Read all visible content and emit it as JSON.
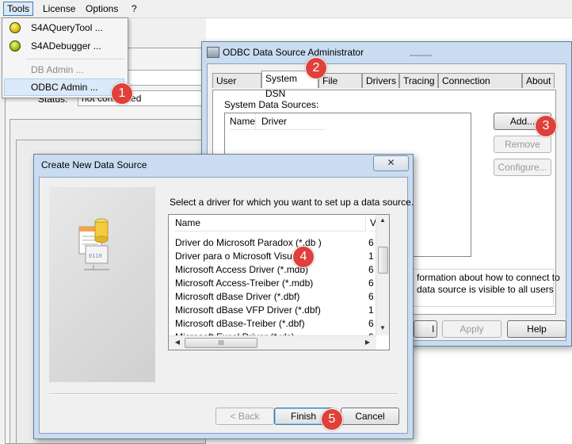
{
  "menubar": {
    "tools": "Tools",
    "license": "License",
    "options": "Options",
    "help": "?"
  },
  "tools_menu": {
    "items": [
      {
        "label": "S4AQueryTool ...",
        "icon": "yellow-ball-icon"
      },
      {
        "label": "S4ADebugger ...",
        "icon": "bug-icon"
      },
      {
        "label": "DB Admin ..."
      },
      {
        "label": "ODBC Admin ..."
      }
    ]
  },
  "background_app": {
    "status_label": "Status:",
    "status_value": "not connected"
  },
  "odbc": {
    "title": "ODBC Data Source Administrator",
    "tabs": [
      "User DSN",
      "System DSN",
      "File DSN",
      "Drivers",
      "Tracing",
      "Connection Pooling",
      "About"
    ],
    "section_label": "System Data Sources:",
    "columns": [
      "Name",
      "Driver"
    ],
    "buttons": {
      "add": "Add...",
      "remove": "Remove",
      "configure": "Configure...",
      "apply": "Apply",
      "help": "Help"
    },
    "info_line1": "formation about how to connect to",
    "info_line2": "data source is visible to all users"
  },
  "create_dialog": {
    "title": "Create New Data Source",
    "instruction": "Select a driver for which you want to set up a data source.",
    "columns": {
      "name": "Name",
      "version": "V"
    },
    "drivers": [
      {
        "name": "Driver do Microsoft Paradox (*.db )",
        "version": "6"
      },
      {
        "name": "Driver para o Microsoft Visual F",
        "version": "1"
      },
      {
        "name": "Microsoft Access Driver (*.mdb)",
        "version": "6"
      },
      {
        "name": "Microsoft Access-Treiber (*.mdb)",
        "version": "6"
      },
      {
        "name": "Microsoft dBase Driver (*.dbf)",
        "version": "6"
      },
      {
        "name": "Microsoft dBase VFP Driver (*.dbf)",
        "version": "1"
      },
      {
        "name": "Microsoft dBase-Treiber (*.dbf)",
        "version": "6"
      },
      {
        "name": "Microsoft Excel Driver (*.xls)",
        "version": "6"
      }
    ],
    "scroll_grip": "III",
    "buttons": {
      "back": "< Back",
      "finish": "Finish",
      "cancel": "Cancel"
    }
  },
  "callouts": [
    "1",
    "2",
    "3",
    "4",
    "5"
  ],
  "colors": {
    "badge": "#e0403a",
    "title_bar": "#c9dcf1"
  }
}
